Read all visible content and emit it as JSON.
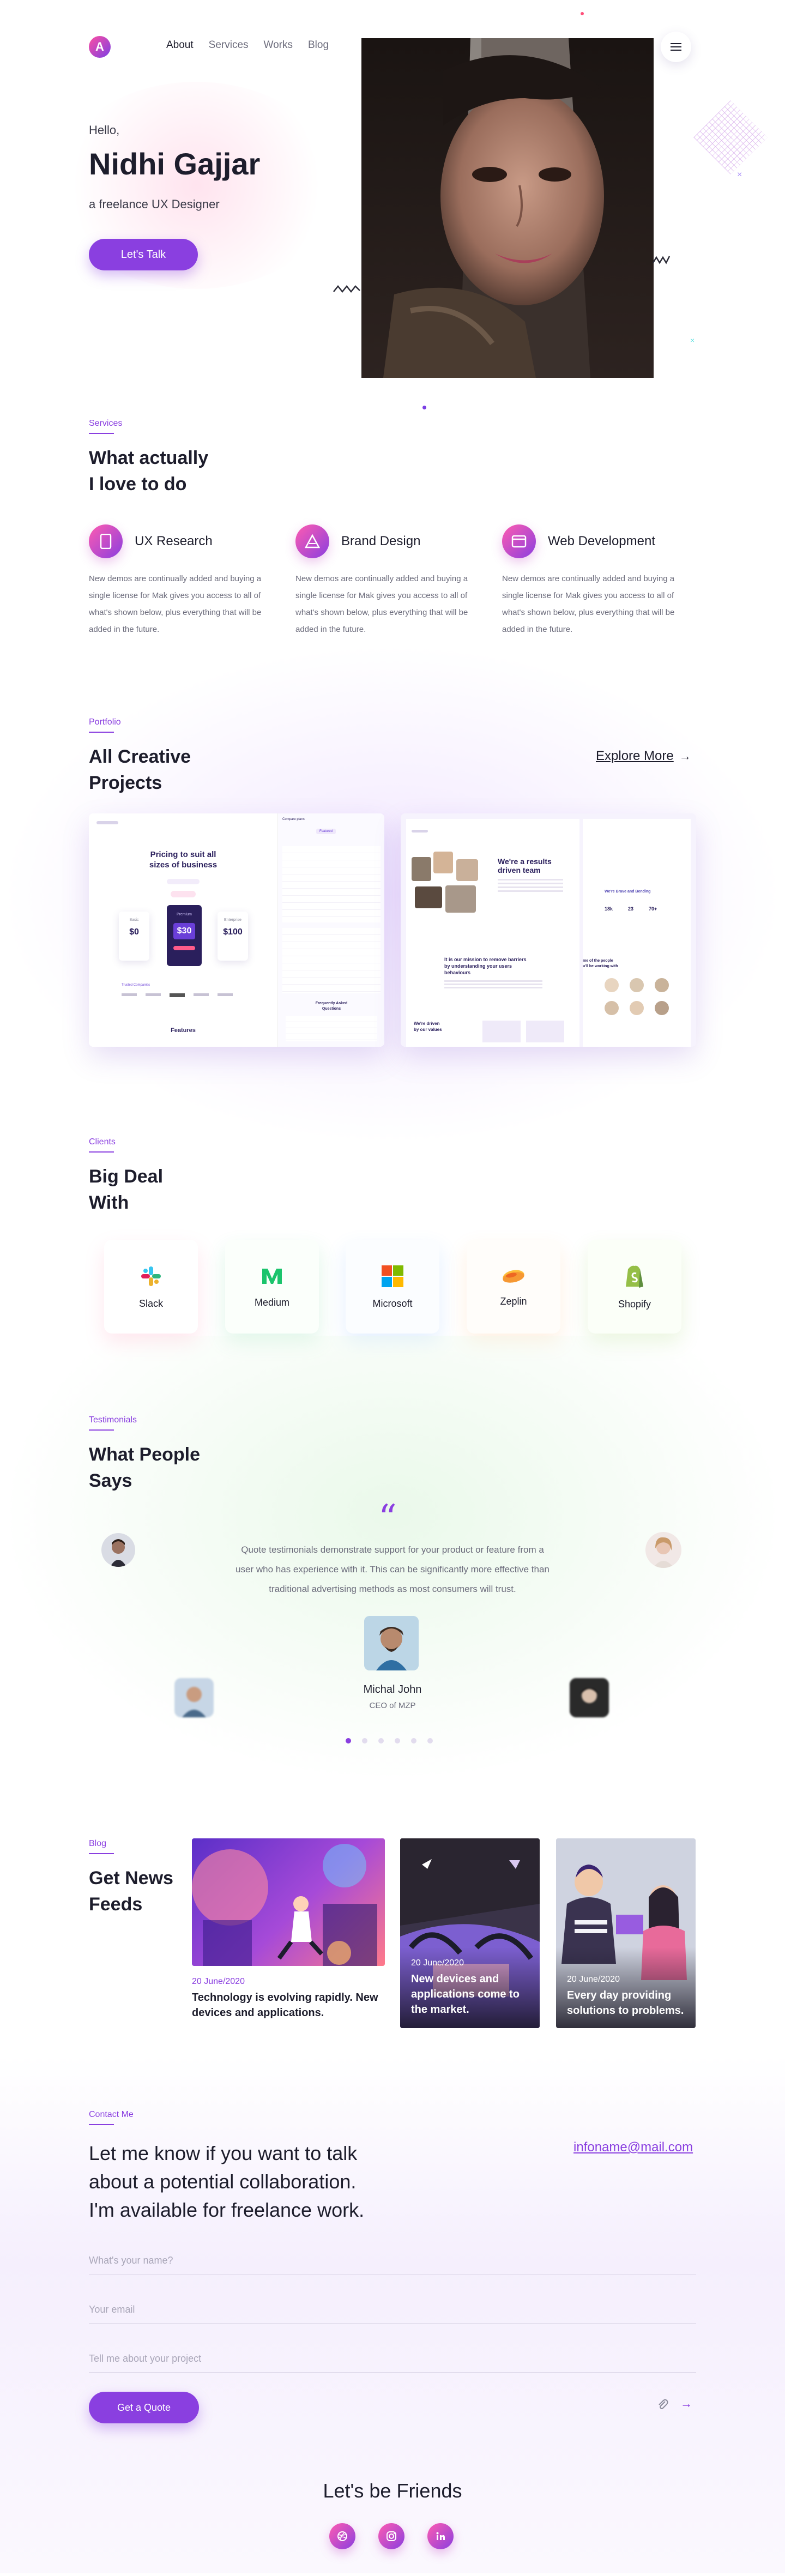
{
  "header": {
    "logo_letter": "A",
    "nav": [
      "About",
      "Services",
      "Works",
      "Blog"
    ],
    "active_nav": "About"
  },
  "hero": {
    "greeting": "Hello,",
    "name": "Nidhi Gajjar",
    "role": "a freelance UX Designer",
    "cta": "Let's Talk"
  },
  "services": {
    "label": "Services",
    "title_line1": "What  actually",
    "title_line2": "I love to do",
    "items": [
      {
        "title": "UX Research",
        "icon": "phone-icon",
        "desc_lines": [
          "New demos are continually added and buying a",
          "single license for Mak gives you access to all of",
          "what's shown below, plus everything that will be",
          "added in the future."
        ]
      },
      {
        "title": "Brand Design",
        "icon": "triangle-logo-icon",
        "desc_lines": [
          "New demos are continually added and buying a",
          "single license for Mak gives you access to all of",
          "what's shown below, plus everything that will be",
          "added in the future."
        ]
      },
      {
        "title": "Web Development",
        "icon": "browser-window-icon",
        "desc_lines": [
          "New demos are continually added and buying a",
          "single license for Mak gives you access to all of",
          "what's shown below, plus everything that will be",
          "added in the future."
        ]
      }
    ]
  },
  "portfolio": {
    "label": "Portfolio",
    "title_line1": "All Creative",
    "title_line2": "Projects",
    "explore": "Explore More",
    "card1": {
      "pricing_title_line1": "Pricing to suit all",
      "pricing_title_line2": "sizes of business",
      "prices": [
        "$0",
        "$30",
        "$100"
      ],
      "plans": [
        "Basic",
        "Premium",
        "Enterprise"
      ],
      "trusted": "Trusted Companies",
      "features": "Features",
      "compare": "Compare plans",
      "featured": "Featured",
      "faq_line1": "Frequently Asked",
      "faq_line2": "Questions"
    },
    "card2": {
      "headline_line1": "We're a results",
      "headline_line2": "driven team",
      "mission_line1": "It is our mission to remove barriers",
      "mission_line2": "by understanding your users",
      "mission_line3": "behaviours",
      "values_line1": "We're driven",
      "values_line2": "by our values",
      "side_title": "We're Brave and Bending",
      "stats": [
        "18k",
        "23",
        "70+"
      ],
      "people_line1": "me of the people",
      "people_line2": "u'll be working with"
    }
  },
  "clients": {
    "label": "Clients",
    "title_line1": "Big Deal",
    "title_line2": "With",
    "items": [
      {
        "name": "Slack",
        "icon": "slack-icon"
      },
      {
        "name": "Medium",
        "icon": "medium-icon"
      },
      {
        "name": "Microsoft",
        "icon": "microsoft-icon"
      },
      {
        "name": "Zeplin",
        "icon": "zeplin-icon"
      },
      {
        "name": "Shopify",
        "icon": "shopify-icon"
      }
    ]
  },
  "testimonials": {
    "label": "Testimonials",
    "title_line1": "What People",
    "title_line2": "Says",
    "quote_mark": "“",
    "quote": "Quote testimonials demonstrate support for your product or feature from a user who has experience with it. This can be significantly more effective than traditional advertising methods as most consumers will trust.",
    "author": "Michal John",
    "author_role": "CEO of MZP",
    "pages": 6,
    "active_page": 1
  },
  "blog": {
    "label": "Blog",
    "title_line1": "Get News",
    "title_line2": "Feeds",
    "posts": [
      {
        "date": "20 June/2020",
        "title_line1": "Technology is evolving rapidly. New",
        "title_line2": "devices and applications."
      },
      {
        "date": "20 June/2020",
        "title_line1": "New devices and",
        "title_line2": "applications come to",
        "title_line3": "the market."
      },
      {
        "date": "20 June/2020",
        "title_line1": "Every day providing",
        "title_line2": "solutions to problems."
      }
    ]
  },
  "contact": {
    "label": "Contact Me",
    "headline_line1": "Let me know if you want to talk",
    "headline_line2": "about a potential collaboration.",
    "headline_line3": "I'm available for freelance work.",
    "email": "infoname@mail.com",
    "name_placeholder": "What's your name?",
    "email_placeholder": "Your email",
    "message_placeholder": "Tell me about your project",
    "submit": "Get a Quote"
  },
  "footer": {
    "friends": "Let's be Friends",
    "socials": [
      "dribbble-icon",
      "instagram-icon",
      "linkedin-icon"
    ]
  },
  "colors": {
    "accent": "#8a3fe0",
    "pink": "#ff5bb0",
    "text": "#1d1d2c",
    "muted": "#6b6b7b"
  }
}
